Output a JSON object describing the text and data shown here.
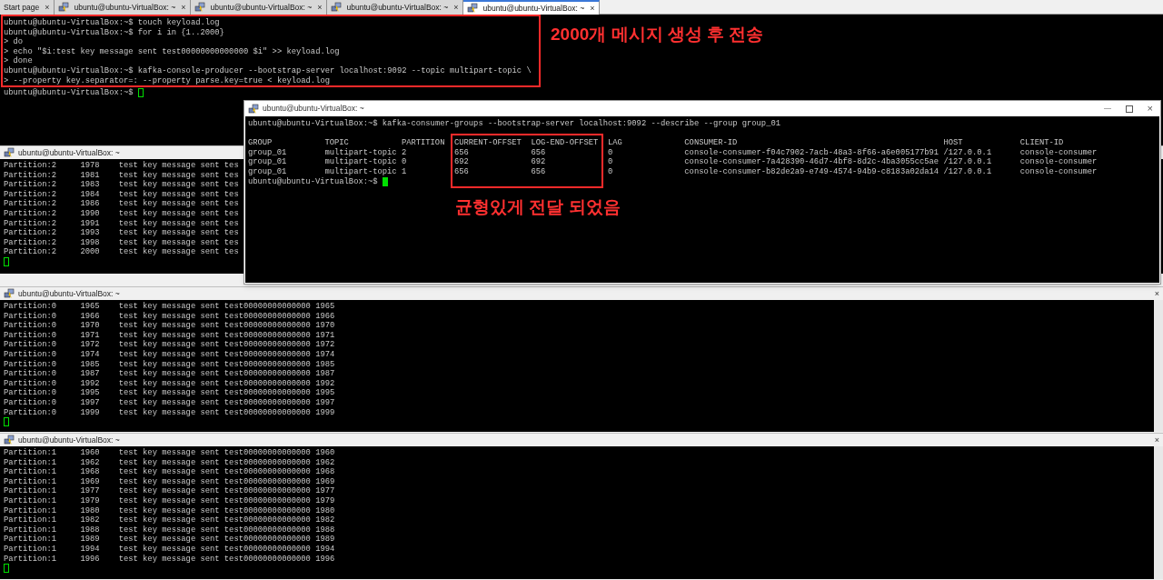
{
  "tabs": [
    {
      "kind": "start",
      "label": "Start page",
      "close": "×",
      "selected": false
    },
    {
      "kind": "session",
      "label": "ubuntu@ubuntu-VirtualBox: ~",
      "close": "×",
      "selected": false
    },
    {
      "kind": "session",
      "label": "ubuntu@ubuntu-VirtualBox: ~",
      "close": "×",
      "selected": false
    },
    {
      "kind": "session",
      "label": "ubuntu@ubuntu-VirtualBox: ~",
      "close": "×",
      "selected": false
    },
    {
      "kind": "session",
      "label": "ubuntu@ubuntu-VirtualBox: ~",
      "close": "×",
      "selected": true
    }
  ],
  "top_terminal": {
    "focused": false,
    "lines": [
      "ubuntu@ubuntu-VirtualBox:~$ touch keyload.log",
      "ubuntu@ubuntu-VirtualBox:~$ for i in {1..2000}",
      "> do",
      "> echo \"$i:test key message sent test00000000000000 $i\" >> keyload.log",
      "> done",
      "ubuntu@ubuntu-VirtualBox:~$ kafka-console-producer --bootstrap-server localhost:9092 --topic multipart-topic \\",
      "> --property key.separator=: --property parse.key=true < keyload.log"
    ],
    "prompt": "ubuntu@ubuntu-VirtualBox:~$",
    "annotation": "2000개 메시지 생성 후 전송"
  },
  "panes": [
    {
      "title": "ubuntu@ubuntu-VirtualBox: ~",
      "focused": false,
      "scrollbar": false,
      "lines": [
        "Partition:2     1978    test key message sent tes",
        "Partition:2     1981    test key message sent tes",
        "Partition:2     1983    test key message sent tes",
        "Partition:2     1984    test key message sent tes",
        "Partition:2     1986    test key message sent tes",
        "Partition:2     1990    test key message sent tes",
        "Partition:2     1991    test key message sent tes",
        "Partition:2     1993    test key message sent tes",
        "Partition:2     1998    test key message sent tes",
        "Partition:2     2000    test key message sent tes"
      ]
    },
    {
      "title": "ubuntu@ubuntu-VirtualBox: ~",
      "close": "×",
      "focused": false,
      "scrollbar": true,
      "lines": [
        "Partition:0     1965    test key message sent test00000000000000 1965",
        "Partition:0     1966    test key message sent test00000000000000 1966",
        "Partition:0     1970    test key message sent test00000000000000 1970",
        "Partition:0     1971    test key message sent test00000000000000 1971",
        "Partition:0     1972    test key message sent test00000000000000 1972",
        "Partition:0     1974    test key message sent test00000000000000 1974",
        "Partition:0     1985    test key message sent test00000000000000 1985",
        "Partition:0     1987    test key message sent test00000000000000 1987",
        "Partition:0     1992    test key message sent test00000000000000 1992",
        "Partition:0     1995    test key message sent test00000000000000 1995",
        "Partition:0     1997    test key message sent test00000000000000 1997",
        "Partition:0     1999    test key message sent test00000000000000 1999"
      ]
    },
    {
      "title": "ubuntu@ubuntu-VirtualBox: ~",
      "close": "×",
      "focused": false,
      "scrollbar": true,
      "lines": [
        "Partition:1     1960    test key message sent test00000000000000 1960",
        "Partition:1     1962    test key message sent test00000000000000 1962",
        "Partition:1     1968    test key message sent test00000000000000 1968",
        "Partition:1     1969    test key message sent test00000000000000 1969",
        "Partition:1     1977    test key message sent test00000000000000 1977",
        "Partition:1     1979    test key message sent test00000000000000 1979",
        "Partition:1     1980    test key message sent test00000000000000 1980",
        "Partition:1     1982    test key message sent test00000000000000 1982",
        "Partition:1     1988    test key message sent test00000000000000 1988",
        "Partition:1     1989    test key message sent test00000000000000 1989",
        "Partition:1     1994    test key message sent test00000000000000 1994",
        "Partition:1     1996    test key message sent test00000000000000 1996"
      ]
    }
  ],
  "consumer_window": {
    "title": "ubuntu@ubuntu-VirtualBox: ~",
    "close": "×",
    "focused": true,
    "command": "ubuntu@ubuntu-VirtualBox:~$ kafka-consumer-groups --bootstrap-server localhost:9092 --describe --group group_01",
    "table": {
      "columns": [
        "GROUP",
        "TOPIC",
        "PARTITION",
        "CURRENT-OFFSET",
        "LOG-END-OFFSET",
        "LAG",
        "CONSUMER-ID",
        "HOST",
        "CLIENT-ID"
      ],
      "rows": [
        [
          "group_01",
          "multipart-topic",
          "2",
          "656",
          "656",
          "0",
          "console-consumer-f04c7902-7acb-48a3-8f66-a6e005177b91",
          "/127.0.0.1",
          "console-consumer"
        ],
        [
          "group_01",
          "multipart-topic",
          "0",
          "692",
          "692",
          "0",
          "console-consumer-7a428390-46d7-4bf8-8d2c-4ba3055cc5ae",
          "/127.0.0.1",
          "console-consumer"
        ],
        [
          "group_01",
          "multipart-topic",
          "1",
          "656",
          "656",
          "0",
          "console-consumer-b82de2a9-e749-4574-94b9-c8183a02da14",
          "/127.0.0.1",
          "console-consumer"
        ]
      ]
    },
    "prompt": "ubuntu@ubuntu-VirtualBox:~$",
    "annotation": "균형있게 전달 되었음"
  }
}
